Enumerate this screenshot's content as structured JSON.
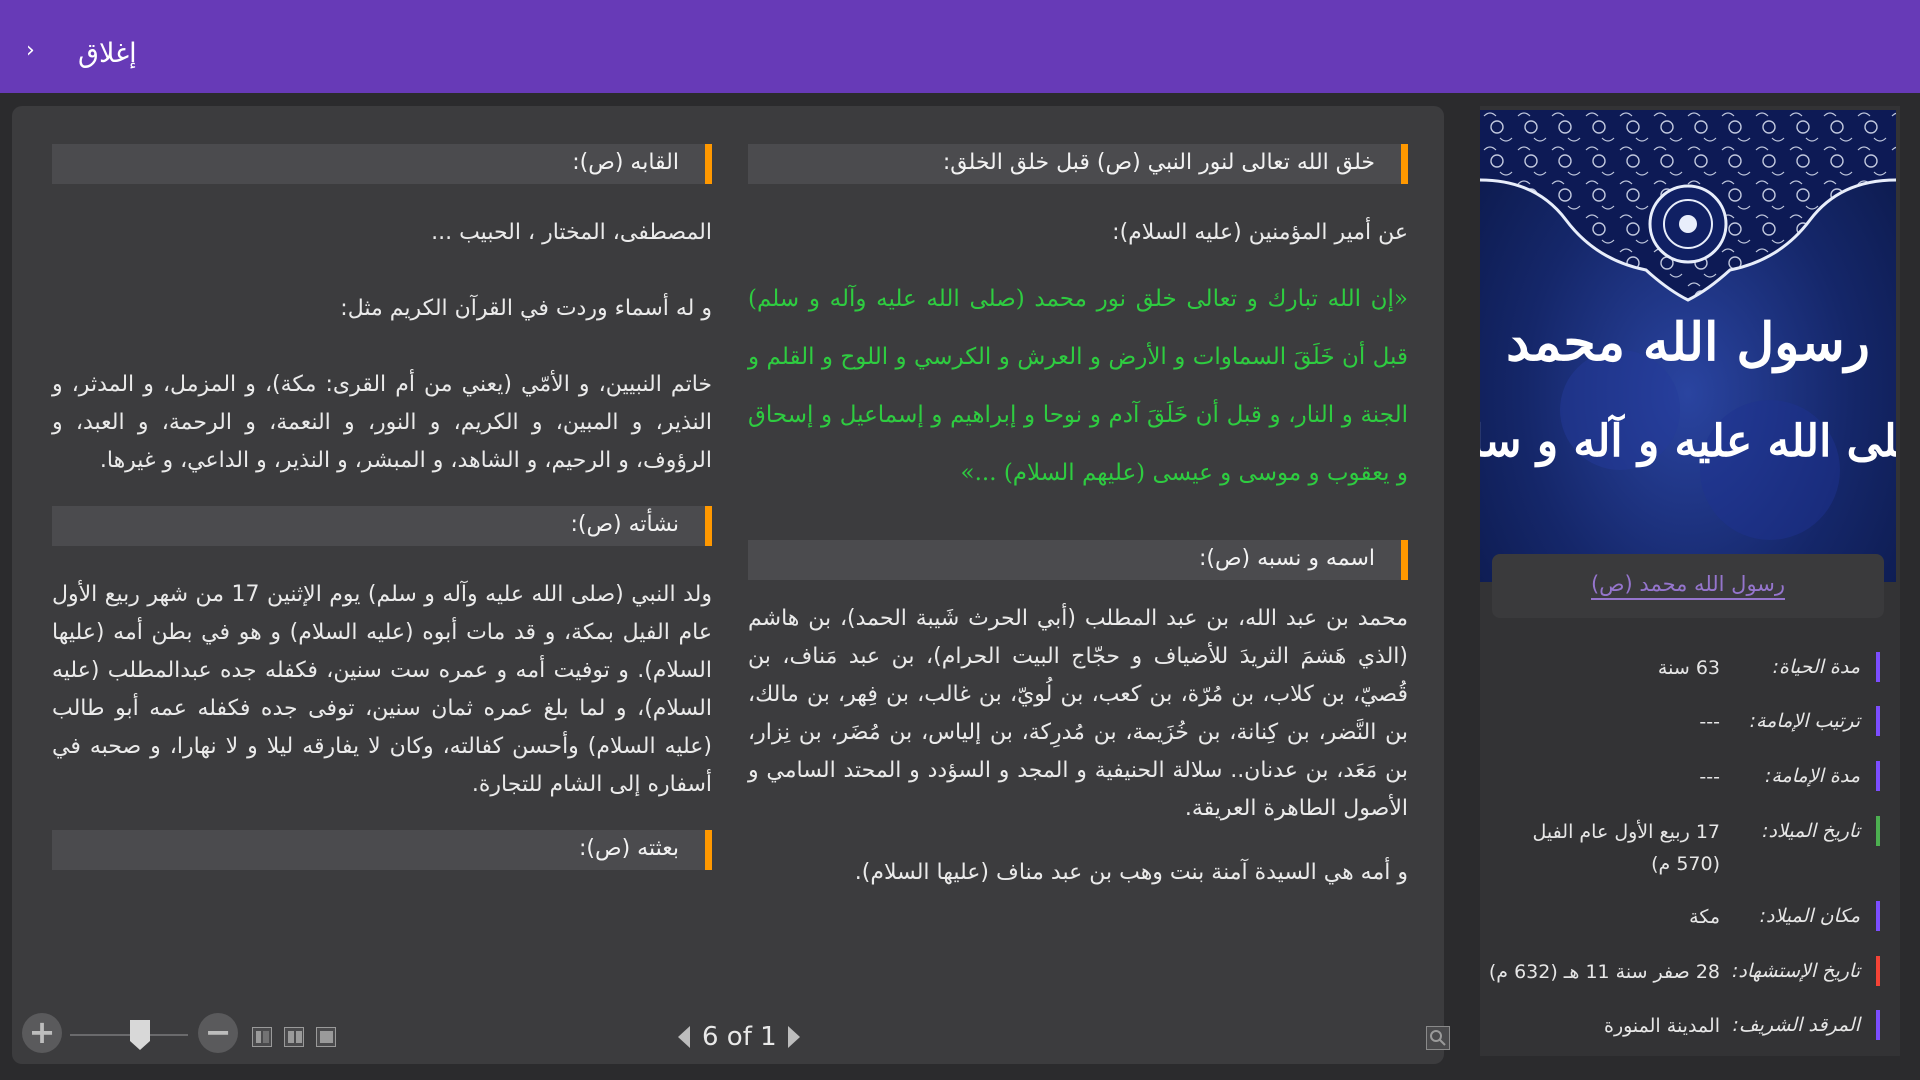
{
  "header": {
    "chevron_glyph": "›",
    "close_label": "إغلاق"
  },
  "reader": {
    "right_column": {
      "section1_title": "خلق الله تعالى لنور النبي (ص) قبل خلق الخلق:",
      "intro": "عن أمير المؤمنين (عليه السلام):",
      "quote": "«إن الله تبارك و تعالى خلق نور محمد (صلى الله عليه وآله و سلم) قبل أن خَلَقَ السماوات و الأرض و العرش و الكرسي و اللوح و القلم و الجنة و النار، و قبل أن خَلَقَ آدم و نوحا و إبراهيم و إسماعيل و إسحاق و يعقوب و موسى و عيسى (عليهم السلام) ...»",
      "section2_title": "اسمه و نسبه (ص):",
      "lineage": "محمد بن عبد الله، بن عبد المطلب (أبي الحرث شَيبة الحمد)، بن هاشم (الذي هَشمَ الثريدَ للأضياف و حجّاج البيت الحرام)، بن عبد مَناف، بن قُصيّ، بن كلاب، بن مُرّة، بن كعب، بن لُويّ، بن غالب، بن فِهر، بن مالك، بن النَّضر، بن كِنانة، بن خُزَيمة، بن مُدرِكة، بن إلياس، بن مُضَر، بن نِزار، بن مَعَد، بن عدنان.. سلالة الحنيفية و المجد و السؤدد و المحتد السامي و الأصول الطاهرة العريقة.",
      "mother": "و أمه هي السيدة آمنة بنت وهب بن عبد مناف (عليها السلام)."
    },
    "left_column": {
      "section1_title": "القابه (ص):",
      "titles": "المصطفى، المختار ، الحبيب ...",
      "names_intro": "و له أسماء وردت في القرآن الكريم مثل:",
      "names": "خاتم النبيين، و الأمّي (يعني من أم القرى: مكة)، و المزمل، و المدثر، و النذير، و المبين، و الكريم، و النور، و النعمة، و الرحمة، و العبد، و الرؤوف، و الرحيم، و الشاهد، و المبشر، و النذير، و الداعي، و غيرها.",
      "section2_title": "نشأته (ص):",
      "upbringing": "ولد النبي (صلى الله عليه وآله و سلم) يوم الإثنين 17 من شهر ربيع الأول عام الفيل بمكة، و قد مات أبوه (عليه السلام) و هو في بطن أمه (عليها السلام). و توفيت أمه و عمره ست سنين، فكفله جده عبدالمطلب (عليه السلام)، و لما بلغ عمره ثمان سنين، توفى جده فكفله عمه أبو طالب (عليه السلام) وأحسن كفالته، وكان لا يفارقه ليلا و لا نهارا، و صحبه في أسفاره إلى الشام للتجارة.",
      "section3_title": "بعثته (ص):"
    },
    "toolbar": {
      "zoom_in_glyph": "+",
      "zoom_out_glyph": "−",
      "page_text": "6 of 1"
    }
  },
  "info_panel": {
    "cover_line1": "رسول الله محمد",
    "cover_line2": "صلى الله عليه و آله و سلم",
    "name_link": "رسول الله محمد (ص)",
    "rows": [
      {
        "label": "مدة الحياة:",
        "value": "63 سنة",
        "color": "#7c4dff"
      },
      {
        "label": "ترتيب الإمامة:",
        "value": "---",
        "color": "#7c4dff"
      },
      {
        "label": "مدة الإمامة:",
        "value": "---",
        "color": "#7c4dff"
      },
      {
        "label": "تاريخ الميلاد:",
        "value": "17 ربيع الأول عام الفيل (570 م)",
        "color": "#4caf50"
      },
      {
        "label": "مكان الميلاد:",
        "value": "مكة",
        "color": "#7c4dff"
      },
      {
        "label": "تاريخ الإستشهاد:",
        "value": "28 صفر سنة 11 هـ (632 م)",
        "color": "#f44336"
      },
      {
        "label": "المرقد الشريف:",
        "value": "المدينة المنورة",
        "color": "#7c4dff"
      }
    ]
  },
  "colors": {
    "header": "#673ab7",
    "section_accent": "#ff9800",
    "quote_text": "#2ecc40",
    "link": "#9575cd"
  }
}
